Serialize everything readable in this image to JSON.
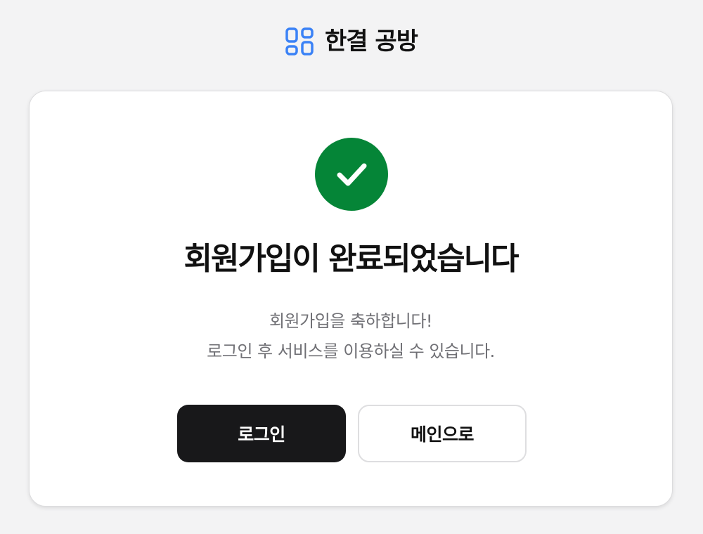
{
  "brand": {
    "icon": "grid-blocks-icon",
    "name": "한결 공방",
    "accent_color": "#3b82f6"
  },
  "success": {
    "icon": "check-circle-icon",
    "icon_color": "#058537",
    "title": "회원가입이 완료되었습니다",
    "message_line1": "회원가입을 축하합니다!",
    "message_line2": "로그인 후 서비스를 이용하실 수 있습니다."
  },
  "actions": {
    "login_label": "로그인",
    "main_label": "메인으로"
  }
}
